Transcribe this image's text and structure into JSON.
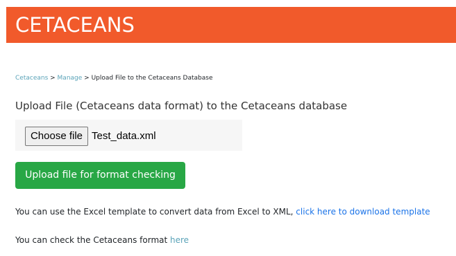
{
  "header": {
    "title": "CETACEANS",
    "color": "#f15a2b"
  },
  "breadcrumb": {
    "items": [
      {
        "label": "Cetaceans",
        "link": true
      },
      {
        "label": "Manage",
        "link": true
      },
      {
        "label": "Upload File to the Cetaceans Database",
        "link": false
      }
    ],
    "separator": ">"
  },
  "page": {
    "heading": "Upload File (Cetaceans data format) to the Cetaceans database"
  },
  "file_input": {
    "button_label": "Choose file",
    "selected_file": "Test_data.xml"
  },
  "upload_button": {
    "label": "Upload file for format checking",
    "color": "#28a745"
  },
  "info": {
    "template_text": "You can use the Excel template to convert data from Excel to XML, ",
    "template_link": "click here to download template",
    "format_text": "You can check the Cetaceans format ",
    "format_link": "here"
  }
}
